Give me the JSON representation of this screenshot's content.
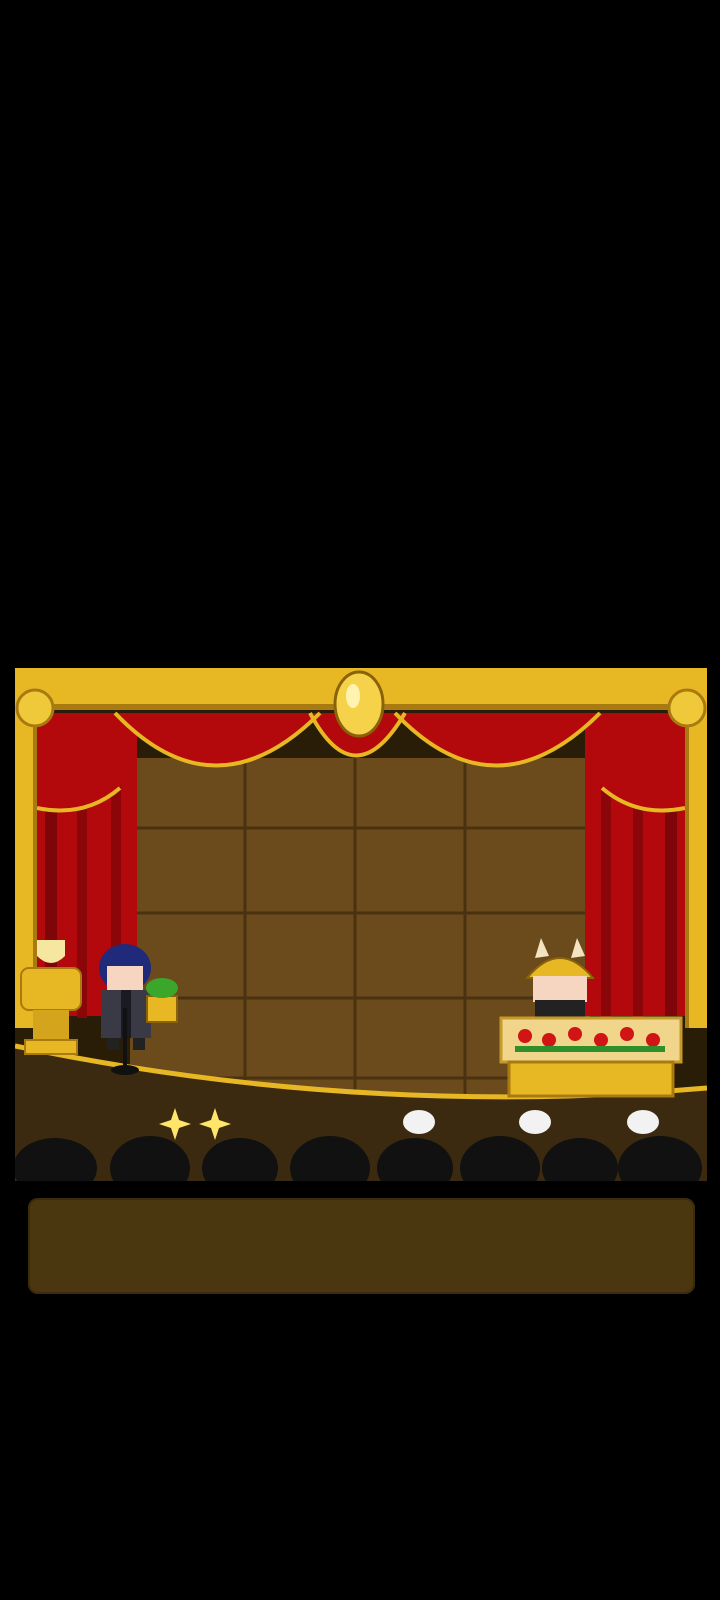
{
  "scene": {
    "name": "theater-stage",
    "colors": {
      "frame_gold": "#e7b824",
      "frame_gold_dark": "#a87a10",
      "curtain_red": "#b3080c",
      "curtain_dark": "#6a0407",
      "backdrop_brown": "#6b4a1c",
      "floor_brown": "#3b2a10",
      "audience": "#111111"
    },
    "props": [
      "trophy-icon",
      "microphone-stand-icon",
      "potted-plant-icon",
      "flower-podium-icon",
      "gold-oval-ornament-icon"
    ],
    "characters": [
      "host-character",
      "rabbit-helmet-character"
    ]
  },
  "dialog": {
    "text": ""
  }
}
